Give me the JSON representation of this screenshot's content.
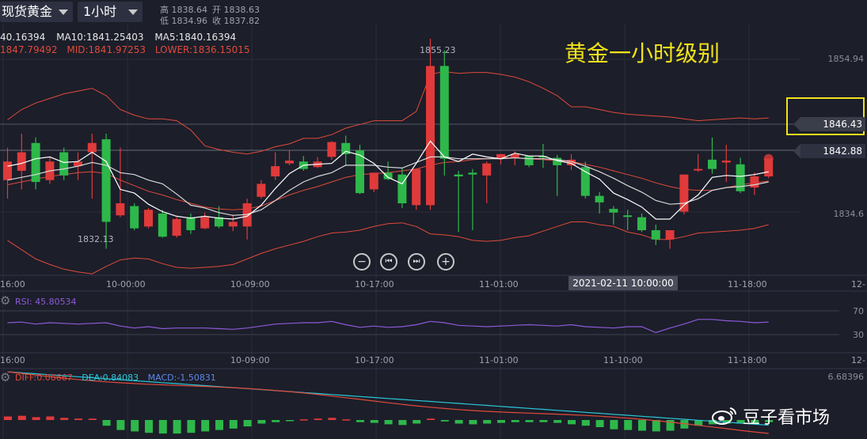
{
  "header": {
    "symbol_label": "现货黄金",
    "timeframe_label": "1小时",
    "high_label": "高 1838.64",
    "low_label": "低 1834.96",
    "open_label": "开 1838.63",
    "close_label": "收 1837.82"
  },
  "indicators": {
    "ma20": "40.16394",
    "ma10": "MA10:1841.25403",
    "ma5": "MA5:1840.16394",
    "upper": "1847.79492",
    "mid": "MID:1841.97253",
    "lower": "LOWER:1836.15015"
  },
  "annotation": "黄金一小时级别",
  "price_tags": {
    "tag1": "1846.43",
    "tag2": "1842.88"
  },
  "axis_labels": {
    "top": "1854.94",
    "bottom": "1834.6",
    "high_mark": "1855.23",
    "low_mark": "1832.13"
  },
  "controls": {
    "zoom_out": "−",
    "prev": "⏮",
    "next": "⏭",
    "zoom_in": "+"
  },
  "time_axis": [
    "16:00",
    "10-00:00",
    "10-09:00",
    "10-17:00",
    "11-01:00",
    "11-18:00",
    "12-"
  ],
  "time_axis2": [
    "16:00",
    "10-09:00",
    "10-17:00",
    "11-01:00",
    "11-10:00",
    "11-18:00",
    "12-"
  ],
  "time_highlight": "2021-02-11 10:00:00",
  "rsi": {
    "label": "RSI: 45.80534",
    "level_high": "70",
    "level_low": "30"
  },
  "macd": {
    "diff": "DIFF:0.08667",
    "dea": "DEA:0.84083",
    "macd": "MACD:-1.50831",
    "scale": "6.68396"
  },
  "watermark": "豆子看市场",
  "colors": {
    "up": "#e03a3a",
    "down": "#2eb84a",
    "ma5": "#ffffff",
    "boll": "#e04a3a",
    "rsi": "#8d5ad8",
    "dea": "#2ac8d8",
    "highlight": "#f2e21a"
  },
  "chart_data": {
    "type": "candlestick",
    "title": "黄金一小时级别",
    "candles": [
      {
        "o": 1842,
        "h": 1843.5,
        "c": 1840,
        "l": 1838,
        "dir": "up"
      },
      {
        "o": 1841,
        "h": 1845,
        "c": 1843,
        "l": 1839,
        "dir": "up"
      },
      {
        "o": 1844,
        "h": 1844.6,
        "c": 1839.8,
        "l": 1839,
        "dir": "down"
      },
      {
        "o": 1840,
        "h": 1842.5,
        "c": 1842,
        "l": 1839.6,
        "dir": "up"
      },
      {
        "o": 1843,
        "h": 1843.5,
        "c": 1840.5,
        "l": 1840,
        "dir": "down"
      },
      {
        "o": 1842,
        "h": 1843,
        "c": 1841.5,
        "l": 1840,
        "dir": "up"
      },
      {
        "o": 1844,
        "h": 1845,
        "c": 1843,
        "l": 1838,
        "dir": "up"
      },
      {
        "o": 1844.4,
        "h": 1845,
        "c": 1835.5,
        "l": 1832.6,
        "dir": "down"
      },
      {
        "o": 1836.2,
        "h": 1843.5,
        "c": 1837.5,
        "l": 1836,
        "dir": "up"
      },
      {
        "o": 1837.2,
        "h": 1837.5,
        "c": 1834.8,
        "l": 1834.6,
        "dir": "down"
      },
      {
        "o": 1835,
        "h": 1837,
        "c": 1836.8,
        "l": 1834.8,
        "dir": "up"
      },
      {
        "o": 1836.4,
        "h": 1836.8,
        "c": 1833.9,
        "l": 1833.8,
        "dir": "down"
      },
      {
        "o": 1834,
        "h": 1836,
        "c": 1835.8,
        "l": 1833.8,
        "dir": "up"
      },
      {
        "o": 1836,
        "h": 1836.4,
        "c": 1834.6,
        "l": 1834.2,
        "dir": "down"
      },
      {
        "o": 1834.8,
        "h": 1836.5,
        "c": 1836,
        "l": 1834.7,
        "dir": "up"
      },
      {
        "o": 1836,
        "h": 1837.2,
        "c": 1835,
        "l": 1834.8,
        "dir": "down"
      },
      {
        "o": 1835,
        "h": 1836.3,
        "c": 1835.5,
        "l": 1834.5,
        "dir": "up"
      },
      {
        "o": 1835,
        "h": 1838,
        "c": 1837.5,
        "l": 1833.6,
        "dir": "up"
      },
      {
        "o": 1838.2,
        "h": 1840,
        "c": 1839.6,
        "l": 1838,
        "dir": "up"
      },
      {
        "o": 1840.4,
        "h": 1843,
        "c": 1841.5,
        "l": 1840,
        "dir": "up"
      },
      {
        "o": 1841.8,
        "h": 1843.2,
        "c": 1842.1,
        "l": 1841.6,
        "dir": "up"
      },
      {
        "o": 1842,
        "h": 1842.6,
        "c": 1841.2,
        "l": 1841,
        "dir": "down"
      },
      {
        "o": 1841.4,
        "h": 1842.5,
        "c": 1842,
        "l": 1841.3,
        "dir": "up"
      },
      {
        "o": 1842.5,
        "h": 1844.2,
        "c": 1844.1,
        "l": 1842.2,
        "dir": "up"
      },
      {
        "o": 1844,
        "h": 1844.8,
        "c": 1842.8,
        "l": 1841.5,
        "dir": "down"
      },
      {
        "o": 1843.2,
        "h": 1843.8,
        "c": 1838.6,
        "l": 1838.5,
        "dir": "down"
      },
      {
        "o": 1839,
        "h": 1840,
        "c": 1840.8,
        "l": 1838.7,
        "dir": "up"
      },
      {
        "o": 1840.8,
        "h": 1842,
        "c": 1840.1,
        "l": 1840,
        "dir": "down"
      },
      {
        "o": 1840.6,
        "h": 1841.3,
        "c": 1837.5,
        "l": 1837,
        "dir": "down"
      },
      {
        "o": 1837.3,
        "h": 1841,
        "c": 1841.2,
        "l": 1836.8,
        "dir": "up"
      },
      {
        "o": 1852.3,
        "h": 1855.23,
        "c": 1837.3,
        "l": 1836.8,
        "dir": "up"
      },
      {
        "o": 1852.3,
        "h": 1854,
        "c": 1842.3,
        "l": 1840.5,
        "dir": "down"
      },
      {
        "o": 1840.6,
        "h": 1841,
        "c": 1840.4,
        "l": 1834.4,
        "dir": "down"
      },
      {
        "o": 1840.8,
        "h": 1841.2,
        "c": 1840.6,
        "l": 1834.6,
        "dir": "down"
      },
      {
        "o": 1841.8,
        "h": 1842,
        "c": 1840.5,
        "l": 1837.5,
        "dir": "up"
      },
      {
        "o": 1842.3,
        "h": 1842.8,
        "c": 1842.8,
        "l": 1841.7,
        "dir": "up"
      },
      {
        "o": 1842.8,
        "h": 1843.1,
        "c": 1842.4,
        "l": 1841.6,
        "dir": "up"
      },
      {
        "o": 1841.6,
        "h": 1842.3,
        "c": 1842.6,
        "l": 1841.4,
        "dir": "down"
      },
      {
        "o": 1842.6,
        "h": 1843.9,
        "c": 1842.5,
        "l": 1841.3,
        "dir": "down"
      },
      {
        "o": 1842.4,
        "h": 1842.7,
        "c": 1841.6,
        "l": 1838.3,
        "dir": "down"
      },
      {
        "o": 1842.2,
        "h": 1842.8,
        "c": 1841.6,
        "l": 1841.1,
        "dir": "up"
      },
      {
        "o": 1841.4,
        "h": 1842,
        "c": 1838.3,
        "l": 1838,
        "dir": "down"
      },
      {
        "o": 1838.3,
        "h": 1838.7,
        "c": 1837.6,
        "l": 1836.4,
        "dir": "down"
      },
      {
        "o": 1836.9,
        "h": 1837.2,
        "c": 1836.5,
        "l": 1835.2,
        "dir": "down"
      },
      {
        "o": 1836.2,
        "h": 1836.8,
        "c": 1836.2,
        "l": 1834.6,
        "dir": "down"
      },
      {
        "o": 1836,
        "h": 1836.4,
        "c": 1834.6,
        "l": 1834.4,
        "dir": "down"
      },
      {
        "o": 1834.6,
        "h": 1835.2,
        "c": 1833.6,
        "l": 1833,
        "dir": "down"
      },
      {
        "o": 1833.6,
        "h": 1834.2,
        "c": 1834.6,
        "l": 1832.6,
        "dir": "up"
      },
      {
        "o": 1836.6,
        "h": 1840.4,
        "c": 1840.6,
        "l": 1836.3,
        "dir": "up"
      },
      {
        "o": 1841.2,
        "h": 1842.8,
        "c": 1841.2,
        "l": 1840.9,
        "dir": "up"
      },
      {
        "o": 1841.2,
        "h": 1844.6,
        "c": 1842.2,
        "l": 1840.7,
        "dir": "down"
      },
      {
        "o": 1842.1,
        "h": 1843.8,
        "c": 1841.9,
        "l": 1839.8,
        "dir": "up"
      },
      {
        "o": 1841.7,
        "h": 1842.4,
        "c": 1838.8,
        "l": 1838.6,
        "dir": "down"
      },
      {
        "o": 1839.2,
        "h": 1840.8,
        "c": 1840.4,
        "l": 1838.4,
        "dir": "up"
      },
      {
        "o": 1840.4,
        "h": 1841.8,
        "c": 1842.3,
        "l": 1840.2,
        "dir": "up"
      }
    ],
    "ma5": [
      1841.5,
      1841.8,
      1842.3,
      1842.5,
      1841.9,
      1842,
      1843,
      1842,
      1839,
      1838.6,
      1837.4,
      1836.6,
      1836.1,
      1835.9,
      1836.1,
      1835.9,
      1835.8,
      1836.1,
      1837.3,
      1839.1,
      1840.7,
      1841.6,
      1841.7,
      1841.8,
      1843.1,
      1842.7,
      1841.8,
      1840.3,
      1839.6,
      1841.8,
      1844.2,
      1842.5,
      1842,
      1842.8,
      1842.5,
      1842.3,
      1842.9,
      1842.6,
      1842.6,
      1842.1,
      1841.8,
      1840.9,
      1840.1,
      1838.6,
      1837.9,
      1837.1,
      1835.8,
      1835.8,
      1837.3,
      1838.4,
      1840.3,
      1840.5,
      1840.4,
      1840.6,
      1840.9
    ],
    "ma10": [
      1840,
      1840.3,
      1840.6,
      1841,
      1841.2,
      1841.5,
      1841.9,
      1841.6,
      1840.8,
      1840.6,
      1840,
      1839.6,
      1838.5,
      1837.3,
      1837,
      1836.5,
      1836.2,
      1836.3,
      1836.8,
      1837.8,
      1838.9,
      1839.8,
      1840.4,
      1840.8,
      1841.6,
      1841.6,
      1841.6,
      1841.4,
      1841.3,
      1841.9,
      1842.5,
      1842.5,
      1842.3,
      1842.3,
      1842.3,
      1842.3,
      1842.4,
      1842.3,
      1842.3,
      1842.2,
      1842,
      1841.5,
      1840.9,
      1840.2,
      1839.4,
      1838.7,
      1837.8,
      1837.4,
      1837.5,
      1838,
      1838.9,
      1839.2,
      1839.3,
      1839.5,
      1839.8
    ],
    "boll_upper": [
      1846.5,
      1847.6,
      1848.3,
      1848.8,
      1849.3,
      1849.6,
      1849.9,
      1849.1,
      1847.6,
      1847,
      1846.6,
      1846.6,
      1846.4,
      1845.4,
      1843.7,
      1843.3,
      1843,
      1842.8,
      1843.1,
      1843.6,
      1843.9,
      1844.5,
      1844.5,
      1844.9,
      1845.6,
      1846,
      1846.4,
      1846.4,
      1846.4,
      1847.4,
      1851.4,
      1851.7,
      1851.5,
      1851.6,
      1851.6,
      1851.4,
      1851.1,
      1850.6,
      1849.9,
      1849.1,
      1847.9,
      1847.9,
      1847.6,
      1847.3,
      1847.1,
      1847,
      1846.9,
      1846.8,
      1846.6,
      1846.4,
      1846.5,
      1846.6,
      1846.7,
      1846.6,
      1846.7
    ],
    "boll_mid": [
      1839.5,
      1839.8,
      1840.1,
      1840.4,
      1840.6,
      1840.8,
      1840.9,
      1840.7,
      1840,
      1839.4,
      1838.8,
      1838.4,
      1837.9,
      1837.5,
      1837.1,
      1836.9,
      1836.8,
      1836.9,
      1837.2,
      1837.8,
      1838.4,
      1838.9,
      1839.3,
      1839.8,
      1840.3,
      1840.6,
      1840.7,
      1840.8,
      1841,
      1841.2,
      1841.6,
      1841.9,
      1842,
      1842.2,
      1842.3,
      1842.4,
      1842.4,
      1842.3,
      1842.2,
      1842.1,
      1842,
      1841.7,
      1841.4,
      1841,
      1840.6,
      1840.2,
      1839.7,
      1839.3,
      1839,
      1838.9,
      1838.9,
      1839.2,
      1839.5,
      1839.7,
      1839.9
    ],
    "boll_lower": [
      1833.5,
      1832.5,
      1831.5,
      1830.9,
      1830.4,
      1830.1,
      1829.9,
      1830.7,
      1831.4,
      1831.6,
      1831.5,
      1831,
      1830.6,
      1830.5,
      1830.6,
      1830.7,
      1830.9,
      1831.5,
      1832.1,
      1832.6,
      1833,
      1833.4,
      1833.9,
      1834.3,
      1834.4,
      1834.6,
      1835,
      1835.3,
      1835.4,
      1835,
      1834.2,
      1834.1,
      1833.9,
      1833.5,
      1833.4,
      1833.5,
      1833.8,
      1834,
      1834.5,
      1835,
      1835.5,
      1835.5,
      1835.2,
      1835,
      1834.4,
      1834.1,
      1833.6,
      1833.6,
      1833.9,
      1834.3,
      1834.4,
      1834.5,
      1834.6,
      1834.8,
      1835.2
    ],
    "rsi": [
      50,
      51,
      48,
      50,
      49,
      48,
      49,
      50,
      45,
      42,
      44,
      41,
      42,
      42,
      42,
      41,
      40,
      42,
      45,
      48,
      49,
      50,
      50,
      52,
      47,
      43,
      45,
      43,
      44,
      47,
      52,
      50,
      46,
      45,
      44,
      45,
      46,
      47,
      46,
      45,
      47,
      44,
      43,
      42,
      44,
      44,
      35,
      42,
      48,
      55,
      55,
      53,
      52,
      50,
      51
    ],
    "macd_hist": [
      0.5,
      0.6,
      0.4,
      0.5,
      0.3,
      0.2,
      0.2,
      -0.8,
      -1.4,
      -1.6,
      -1.8,
      -1.9,
      -1.9,
      -1.8,
      -1.6,
      -1.4,
      -1.2,
      -0.9,
      -0.5,
      -0.3,
      -0.1,
      0.1,
      0.2,
      0.3,
      0.1,
      -0.3,
      -0.4,
      -0.6,
      -0.7,
      -0.5,
      0.2,
      -0.2,
      -0.5,
      -0.6,
      -0.5,
      -0.4,
      -0.3,
      -0.3,
      -0.3,
      -0.4,
      -0.6,
      -0.8,
      -1.0,
      -1.3,
      -1.4,
      -1.5,
      -1.6,
      -1.5,
      -1.2,
      -0.8,
      -0.6,
      -0.5,
      -0.5,
      -0.4,
      -0.3
    ],
    "price_range": [
      1830,
      1856
    ],
    "rsi_levels": [
      30,
      70
    ]
  }
}
